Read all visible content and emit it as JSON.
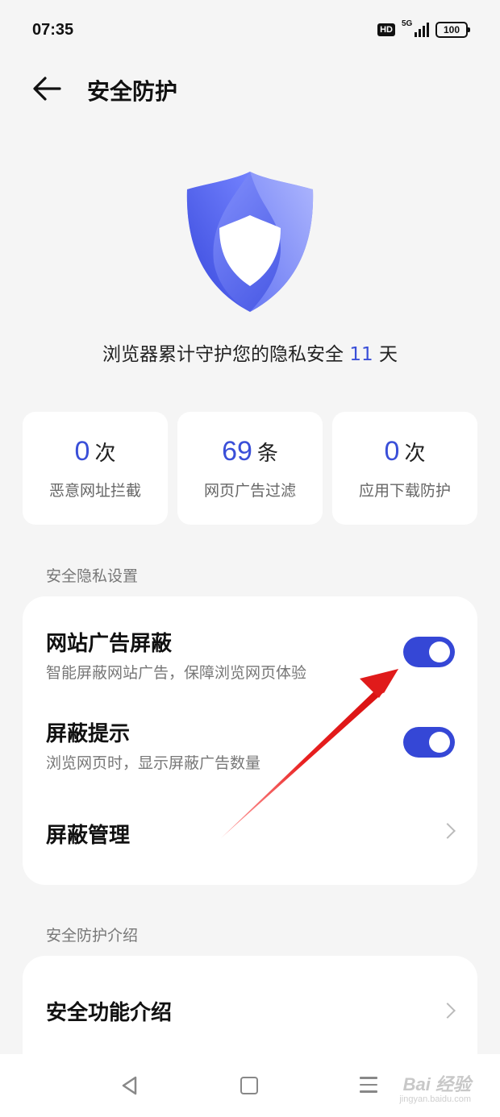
{
  "status_bar": {
    "time": "07:35",
    "hd_label": "HD",
    "network_label": "5G",
    "battery": "100"
  },
  "header": {
    "title": "安全防护",
    "back_icon": "arrow-left-icon"
  },
  "hero": {
    "icon": "shield-icon",
    "guard_text_prefix": "浏览器累计守护您的隐私安全",
    "guard_days": "11",
    "guard_text_suffix": "天"
  },
  "stats": [
    {
      "value": "0",
      "unit": "次",
      "label": "恶意网址拦截"
    },
    {
      "value": "69",
      "unit": "条",
      "label": "网页广告过滤"
    },
    {
      "value": "0",
      "unit": "次",
      "label": "应用下载防护"
    }
  ],
  "privacy_section": {
    "label": "安全隐私设置",
    "items": [
      {
        "title": "网站广告屏蔽",
        "subtitle": "智能屏蔽网站广告，保障浏览网页体验",
        "toggle": true
      },
      {
        "title": "屏蔽提示",
        "subtitle": "浏览网页时，显示屏蔽广告数量",
        "toggle": true
      },
      {
        "title": "屏蔽管理"
      }
    ]
  },
  "intro_section": {
    "label": "安全防护介绍",
    "items": [
      {
        "title": "安全功能介绍"
      }
    ]
  },
  "watermark": {
    "brand": "Bai 经验",
    "url": "jingyan.baidu.com"
  },
  "colors": {
    "accent": "#3547d6",
    "annotation_arrow": "#e01b1b",
    "background": "#f5f5f5"
  }
}
